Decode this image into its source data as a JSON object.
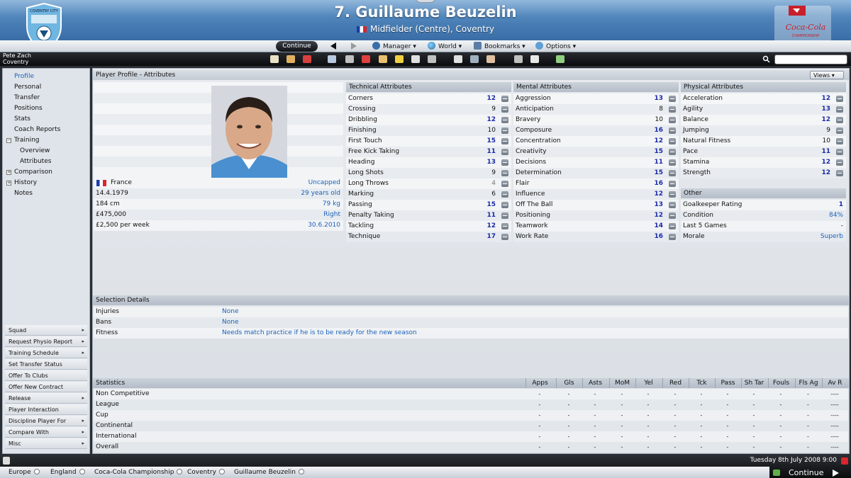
{
  "header": {
    "title": "7. Guillaume Beuzelin",
    "subtitle": "Midfielder (Centre), Coventry",
    "club_crest_text": "COVENTRY CITY",
    "club_crest_bottom": "FOOTBALL CLUB",
    "competition_logo_text": "Coca-Cola",
    "competition_logo_sub": "CHAMPIONSHIP"
  },
  "menubar": {
    "continue": "Continue",
    "manager": "Manager",
    "world": "World",
    "bookmarks": "Bookmarks",
    "options": "Options",
    "dropdown_glyph": "▾"
  },
  "manager": {
    "name": "Pete Zach",
    "club": "Coventry"
  },
  "toolbar_icons": [
    "home-icon",
    "inbox-icon",
    "calendar-icon",
    "squad-icon",
    "tactics-icon",
    "training-icon",
    "scouting-icon",
    "finance-icon",
    "news-icon",
    "trophy-icon",
    "stats-icon",
    "history-icon",
    "transfers-icon",
    "notes-icon",
    "help-icon",
    "settings-icon"
  ],
  "sidebar": {
    "items": [
      {
        "label": "Profile",
        "active": true
      },
      {
        "label": "Personal"
      },
      {
        "label": "Transfer"
      },
      {
        "label": "Positions"
      },
      {
        "label": "Stats"
      },
      {
        "label": "Coach Reports"
      },
      {
        "label": "Training",
        "toggle": "−"
      },
      {
        "label": "Overview",
        "sub": true
      },
      {
        "label": "Attributes",
        "sub": true
      },
      {
        "label": "Comparison",
        "toggle": "+"
      },
      {
        "label": "History",
        "toggle": "+"
      },
      {
        "label": "Notes"
      }
    ],
    "actions": [
      {
        "label": "Squad",
        "arrow": "▸"
      },
      {
        "label": "Request Physio Report",
        "arrow": "▸"
      },
      {
        "label": "Training Schedule",
        "arrow": "▸"
      },
      {
        "label": "Set Transfer Status"
      },
      {
        "label": "Offer To Clubs"
      },
      {
        "label": "Offer New Contract"
      },
      {
        "label": "Release",
        "arrow": "▸"
      },
      {
        "label": "Player Interaction"
      },
      {
        "label": "Discipline Player For",
        "arrow": "▸"
      },
      {
        "label": "Compare With",
        "arrow": "▸"
      },
      {
        "label": "Misc",
        "arrow": "▸"
      }
    ]
  },
  "panel": {
    "title": "Player Profile - Attributes",
    "views": "Views ▾"
  },
  "profile_rows": [
    {
      "label": "France",
      "value": "Uncapped"
    },
    {
      "label": "14.4.1979",
      "value": "29 years old"
    },
    {
      "label": "184 cm",
      "value": "79 kg"
    },
    {
      "label": "£475,000",
      "value": "Right"
    },
    {
      "label": "£2,500 per week",
      "value": "30.6.2010"
    }
  ],
  "technical": {
    "title": "Technical Attributes",
    "rows": [
      {
        "label": "Corners",
        "value": "12",
        "hi": true
      },
      {
        "label": "Crossing",
        "value": "9"
      },
      {
        "label": "Dribbling",
        "value": "12",
        "hi": true
      },
      {
        "label": "Finishing",
        "value": "10"
      },
      {
        "label": "First Touch",
        "value": "15",
        "hi": true
      },
      {
        "label": "Free Kick Taking",
        "value": "11",
        "hi": true
      },
      {
        "label": "Heading",
        "value": "13",
        "hi": true
      },
      {
        "label": "Long Shots",
        "value": "9"
      },
      {
        "label": "Long Throws",
        "value": "4",
        "lo": true
      },
      {
        "label": "Marking",
        "value": "6"
      },
      {
        "label": "Passing",
        "value": "15",
        "hi": true
      },
      {
        "label": "Penalty Taking",
        "value": "11",
        "hi": true
      },
      {
        "label": "Tackling",
        "value": "12",
        "hi": true
      },
      {
        "label": "Technique",
        "value": "17",
        "hi": true
      }
    ]
  },
  "mental": {
    "title": "Mental Attributes",
    "rows": [
      {
        "label": "Aggression",
        "value": "13",
        "hi": true
      },
      {
        "label": "Anticipation",
        "value": "8"
      },
      {
        "label": "Bravery",
        "value": "10"
      },
      {
        "label": "Composure",
        "value": "16",
        "hi": true
      },
      {
        "label": "Concentration",
        "value": "12",
        "hi": true
      },
      {
        "label": "Creativity",
        "value": "15",
        "hi": true
      },
      {
        "label": "Decisions",
        "value": "11",
        "hi": true
      },
      {
        "label": "Determination",
        "value": "15",
        "hi": true
      },
      {
        "label": "Flair",
        "value": "16",
        "hi": true
      },
      {
        "label": "Influence",
        "value": "12",
        "hi": true
      },
      {
        "label": "Off The Ball",
        "value": "13",
        "hi": true
      },
      {
        "label": "Positioning",
        "value": "12",
        "hi": true
      },
      {
        "label": "Teamwork",
        "value": "14",
        "hi": true
      },
      {
        "label": "Work Rate",
        "value": "16",
        "hi": true
      }
    ]
  },
  "physical": {
    "title": "Physical Attributes",
    "rows": [
      {
        "label": "Acceleration",
        "value": "12",
        "hi": true
      },
      {
        "label": "Agility",
        "value": "13",
        "hi": true
      },
      {
        "label": "Balance",
        "value": "12",
        "hi": true
      },
      {
        "label": "Jumping",
        "value": "9"
      },
      {
        "label": "Natural Fitness",
        "value": "10"
      },
      {
        "label": "Pace",
        "value": "11",
        "hi": true
      },
      {
        "label": "Stamina",
        "value": "12",
        "hi": true
      },
      {
        "label": "Strength",
        "value": "12",
        "hi": true
      }
    ]
  },
  "other": {
    "title": "Other",
    "rows": [
      {
        "label": "Goalkeeper Rating",
        "value": "1",
        "hi": true
      },
      {
        "label": "Condition",
        "value": "84%",
        "txt": true
      },
      {
        "label": "Last 5 Games",
        "value": "-"
      },
      {
        "label": "Morale",
        "value": "Superb",
        "txt": true
      }
    ]
  },
  "selection": {
    "title": "Selection Details",
    "rows": [
      {
        "label": "Injuries",
        "value": "None"
      },
      {
        "label": "Bans",
        "value": "None"
      },
      {
        "label": "Fitness",
        "value": "Needs match practice if he is to be ready for the new season"
      }
    ]
  },
  "statistics": {
    "title": "Statistics",
    "columns": [
      "Apps",
      "Gls",
      "Asts",
      "MoM",
      "Yel",
      "Red",
      "Tck",
      "Pass",
      "Sh Tar",
      "Fouls",
      "Fls Ag",
      "Av R"
    ],
    "rows": [
      {
        "label": "Non Competitive",
        "cells": [
          "-",
          "-",
          "-",
          "-",
          "-",
          "-",
          "-",
          "-",
          "-",
          "-",
          "-",
          "----"
        ]
      },
      {
        "label": "League",
        "cells": [
          "-",
          "-",
          "-",
          "-",
          "-",
          "-",
          "-",
          "-",
          "-",
          "-",
          "-",
          "----"
        ]
      },
      {
        "label": "Cup",
        "cells": [
          "-",
          "-",
          "-",
          "-",
          "-",
          "-",
          "-",
          "-",
          "-",
          "-",
          "-",
          "----"
        ]
      },
      {
        "label": "Continental",
        "cells": [
          "-",
          "-",
          "-",
          "-",
          "-",
          "-",
          "-",
          "-",
          "-",
          "-",
          "-",
          "----"
        ]
      },
      {
        "label": "International",
        "cells": [
          "-",
          "-",
          "-",
          "-",
          "-",
          "-",
          "-",
          "-",
          "-",
          "-",
          "-",
          "----"
        ]
      },
      {
        "label": "Overall",
        "cells": [
          "-",
          "-",
          "-",
          "-",
          "-",
          "-",
          "-",
          "-",
          "-",
          "-",
          "-",
          "----"
        ]
      }
    ]
  },
  "status": {
    "date": "Tuesday 8th July 2008 9:00",
    "continue": "Continue"
  },
  "breadcrumbs": [
    "Europe",
    "England",
    "Coca-Cola Championship",
    "Coventry",
    "Guillaume Beuzelin"
  ],
  "colors": {
    "header_blue": "#4a7fb6",
    "value_blue": "#1a2aa8",
    "link_blue": "#1b62b8"
  }
}
